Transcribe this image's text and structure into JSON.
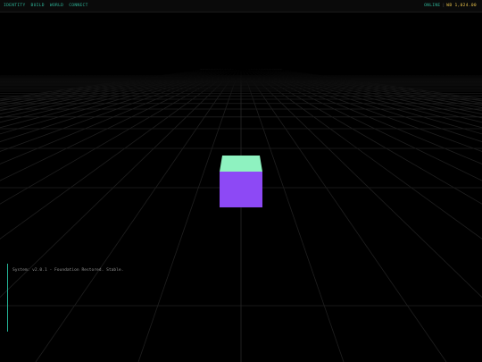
{
  "nav": {
    "items": [
      "IDENTITY",
      "BUILD",
      "WORLD",
      "CONNECT"
    ]
  },
  "status": {
    "online": "ONLINE",
    "separator": "|",
    "balance": "WB 1,024.00"
  },
  "console": {
    "line": "System: v2.0.1 - Foundation Restored. Stable."
  },
  "colors": {
    "accent": "#2fb79a",
    "balance": "#e8c24a",
    "cube_top": "#8ef2c0",
    "cube_front": "#8d49f5",
    "grid": "#1f1f1f"
  },
  "scene": {
    "object": "cube"
  }
}
